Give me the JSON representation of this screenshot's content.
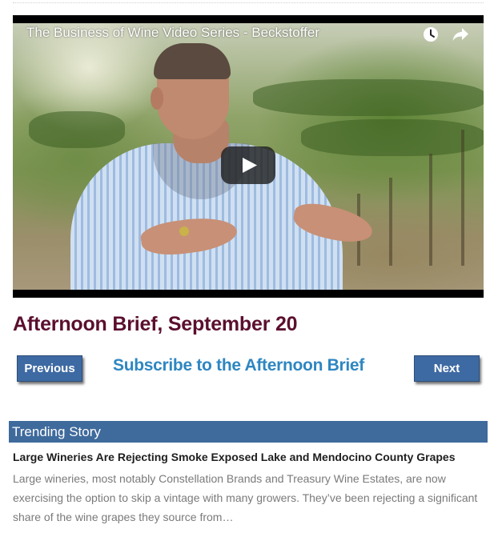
{
  "video": {
    "title": "The Business of Wine Video Series - Beckstoffer",
    "icons": [
      "watch-later-icon",
      "share-icon",
      "play-icon"
    ]
  },
  "article": {
    "title": "Afternoon Brief, September 20"
  },
  "nav": {
    "previous_label": "Previous",
    "subscribe_label": "Subscribe to the Afternoon Brief",
    "next_label": "Next"
  },
  "trending": {
    "heading": "Trending Story",
    "story_title": "Large Wineries Are Rejecting Smoke Exposed Lake and Mendocino County Grapes",
    "excerpt": "Large wineries, most notably Constellation Brands and Treasury Wine Estates, are now exercising the option to skip a vintage with many growers. They’ve been rejecting a significant share of the wine grapes they source from…"
  },
  "colors": {
    "title": "#5b0f2e",
    "button": "#3e6aa3",
    "link": "#2e86c1",
    "trending_bar": "#3f6a9c",
    "excerpt_text": "#7a7a7a"
  }
}
